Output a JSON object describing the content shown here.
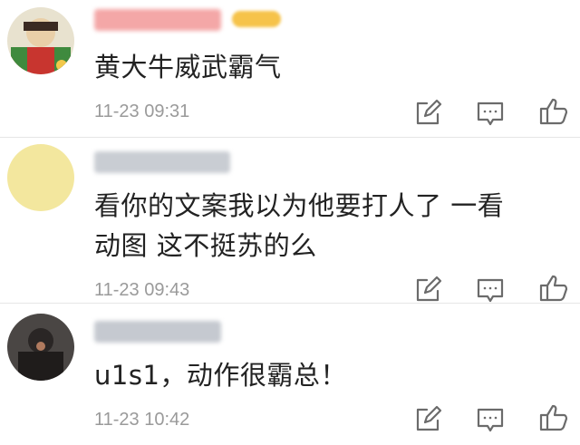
{
  "comments": [
    {
      "text": "黄大牛威武霸气",
      "time": "11-23 09:31",
      "avatar_colors": [
        "#3f8a3e",
        "#c8352f",
        "#e9d59a"
      ],
      "username_color": "#f4a7a7"
    },
    {
      "text_line1": "看你的文案我以为他要打人了  一看",
      "text_line2": "动图 这不挺苏的么",
      "time": "11-23 09:43",
      "avatar_colors": [
        "#f3e79e"
      ],
      "username_color": "#c9cdd3"
    },
    {
      "text": "u1s1，动作很霸总！",
      "time": "11-23 10:42",
      "avatar_colors": [
        "#3a3a3a",
        "#7a6a5a"
      ],
      "username_color": "#c5c9d0"
    }
  ],
  "icons": {
    "edit": "edit-icon",
    "reply": "comment-icon",
    "like": "thumbs-up-icon"
  },
  "colors": {
    "icon_stroke": "#6b6b6b",
    "timestamp": "#9a9a9a",
    "vip_badge": "#f6c34a"
  }
}
